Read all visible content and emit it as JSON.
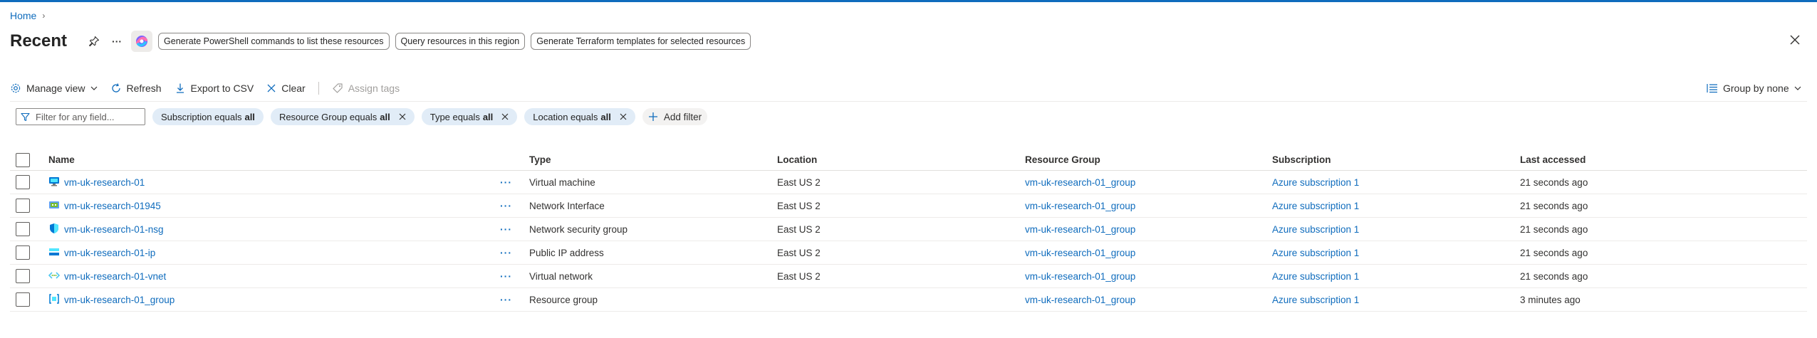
{
  "breadcrumb": {
    "home": "Home",
    "sep": "›"
  },
  "header": {
    "title": "Recent",
    "more": "···",
    "suggestions": [
      "Generate PowerShell commands to list these resources",
      "Query resources in this region",
      "Generate Terraform templates for selected resources"
    ]
  },
  "toolbar": {
    "manage_view": "Manage view",
    "refresh": "Refresh",
    "export_csv": "Export to CSV",
    "clear": "Clear",
    "assign_tags": "Assign tags",
    "group_by": "Group by none"
  },
  "filters": {
    "placeholder": "Filter for any field...",
    "pills": [
      {
        "label": "Subscription equals",
        "value": "all"
      },
      {
        "label": "Resource Group equals",
        "value": "all"
      },
      {
        "label": "Type equals",
        "value": "all"
      },
      {
        "label": "Location equals",
        "value": "all"
      }
    ],
    "add_filter": "Add filter"
  },
  "table": {
    "columns": {
      "name": "Name",
      "type": "Type",
      "location": "Location",
      "resource_group": "Resource Group",
      "subscription": "Subscription",
      "last_accessed": "Last accessed"
    },
    "row_more": "···",
    "rows": [
      {
        "icon": "virtual-machine-icon",
        "name": "vm-uk-research-01",
        "type": "Virtual machine",
        "location": "East US 2",
        "resource_group": "vm-uk-research-01_group",
        "subscription": "Azure subscription 1",
        "last_accessed": "21 seconds ago"
      },
      {
        "icon": "network-interface-icon",
        "name": "vm-uk-research-01945",
        "type": "Network Interface",
        "location": "East US 2",
        "resource_group": "vm-uk-research-01_group",
        "subscription": "Azure subscription 1",
        "last_accessed": "21 seconds ago"
      },
      {
        "icon": "network-security-group-icon",
        "name": "vm-uk-research-01-nsg",
        "type": "Network security group",
        "location": "East US 2",
        "resource_group": "vm-uk-research-01_group",
        "subscription": "Azure subscription 1",
        "last_accessed": "21 seconds ago"
      },
      {
        "icon": "public-ip-icon",
        "name": "vm-uk-research-01-ip",
        "type": "Public IP address",
        "location": "East US 2",
        "resource_group": "vm-uk-research-01_group",
        "subscription": "Azure subscription 1",
        "last_accessed": "21 seconds ago"
      },
      {
        "icon": "virtual-network-icon",
        "name": "vm-uk-research-01-vnet",
        "type": "Virtual network",
        "location": "East US 2",
        "resource_group": "vm-uk-research-01_group",
        "subscription": "Azure subscription 1",
        "last_accessed": "21 seconds ago"
      },
      {
        "icon": "resource-group-icon",
        "name": "vm-uk-research-01_group",
        "type": "Resource group",
        "location": "",
        "resource_group": "vm-uk-research-01_group",
        "subscription": "Azure subscription 1",
        "last_accessed": "3 minutes ago"
      }
    ]
  },
  "colors": {
    "accent": "#0f6cbd",
    "pill_bg": "#e1ecf7",
    "text": "#323130"
  }
}
